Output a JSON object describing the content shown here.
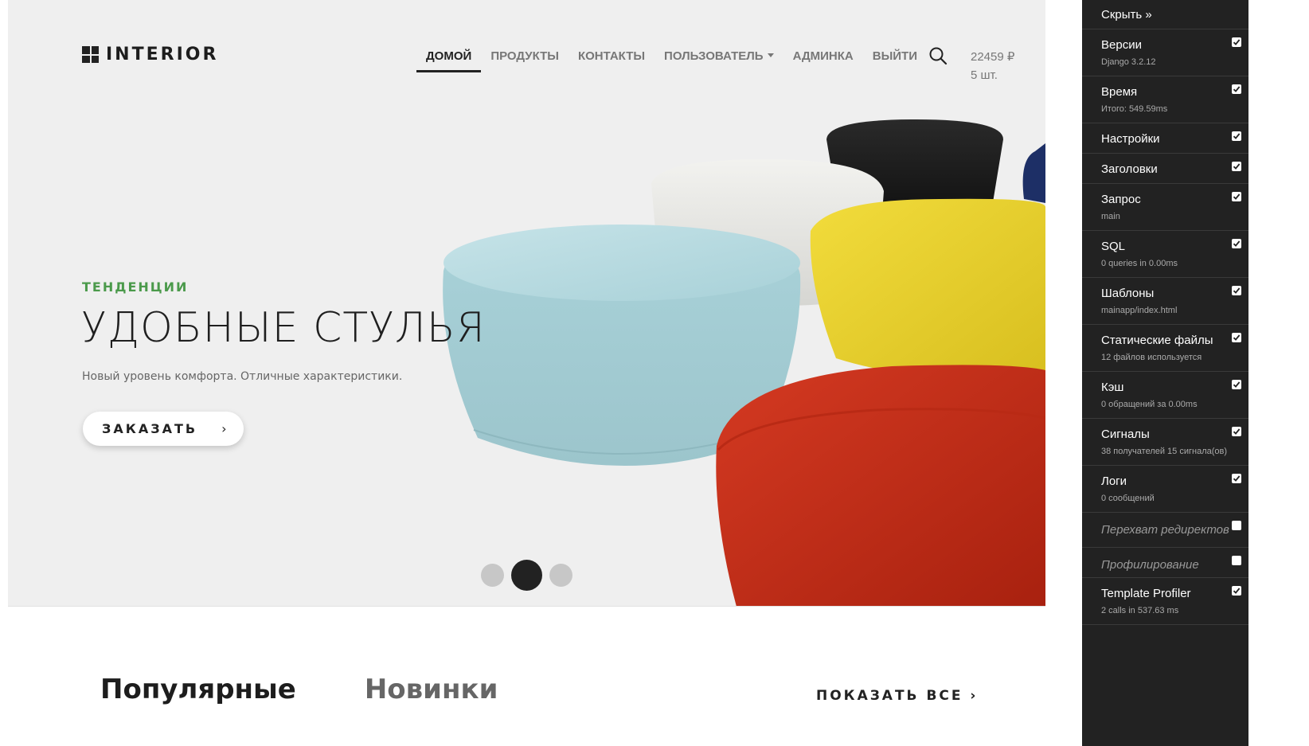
{
  "site": {
    "logo_text": "INTERIOR",
    "nav": [
      {
        "label": "ДОМОЙ",
        "active": true
      },
      {
        "label": "ПРОДУКТЫ",
        "active": false
      },
      {
        "label": "КОНТАКТЫ",
        "active": false
      },
      {
        "label": "ПОЛЬЗОВАТЕЛЬ",
        "active": false,
        "dropdown": true
      },
      {
        "label": "АДМИНКА",
        "active": false
      },
      {
        "label": "ВЫЙТИ",
        "active": false
      }
    ],
    "cart": {
      "total": "22459 ₽",
      "count": "5 шт."
    }
  },
  "hero": {
    "eyebrow": "ТЕНДЕНЦИИ",
    "title": "УДОБНЫЕ СТУЛЬЯ",
    "subtitle": "Новый уровень комфорта. Отличные характеристики.",
    "cta_label": "ЗАКАЗАТЬ",
    "cta_chevron": "›",
    "slides_total": 3,
    "active_slide": 2,
    "accent_color": "#4b9a4b"
  },
  "products": {
    "tabs": [
      "Популярные",
      "Новинки"
    ],
    "show_all": "ПОКАЗАТЬ ВСЕ ›"
  },
  "debug_toolbar": {
    "hide_label": "Скрыть »",
    "panels": [
      {
        "title": "Версии",
        "subtitle": "Django 3.2.12",
        "enabled": true
      },
      {
        "title": "Время",
        "subtitle": "Итого: 549.59ms",
        "enabled": true
      },
      {
        "title": "Настройки",
        "subtitle": "",
        "enabled": true
      },
      {
        "title": "Заголовки",
        "subtitle": "",
        "enabled": true
      },
      {
        "title": "Запрос",
        "subtitle": "main",
        "enabled": true
      },
      {
        "title": "SQL",
        "subtitle": "0 queries in 0.00ms",
        "enabled": true
      },
      {
        "title": "Шаблоны",
        "subtitle": "mainapp/index.html",
        "enabled": true
      },
      {
        "title": "Статические файлы",
        "subtitle": "12 файлов используется",
        "enabled": true
      },
      {
        "title": "Кэш",
        "subtitle": "0 обращений за 0.00ms",
        "enabled": true
      },
      {
        "title": "Сигналы",
        "subtitle": "38 получателей 15 сигнала(ов)",
        "enabled": true
      },
      {
        "title": "Логи",
        "subtitle": "0 сообщений",
        "enabled": true
      },
      {
        "title": "Перехват редиректов",
        "subtitle": "",
        "enabled": false
      },
      {
        "title": "Профилирование",
        "subtitle": "",
        "enabled": false
      },
      {
        "title": "Template Profiler",
        "subtitle": "2 calls in 537.63 ms",
        "enabled": true
      }
    ]
  },
  "icons": [
    "logo-grid-icon",
    "search-icon",
    "dropdown-caret-icon",
    "chevron-right-icon",
    "checkbox-icon"
  ],
  "colors": {
    "hero_bg": "#efefef",
    "toolbar_bg": "#222222",
    "text_dark": "#1d1d1d",
    "nav_muted": "#777777",
    "accent_green": "#4b9a4b"
  }
}
